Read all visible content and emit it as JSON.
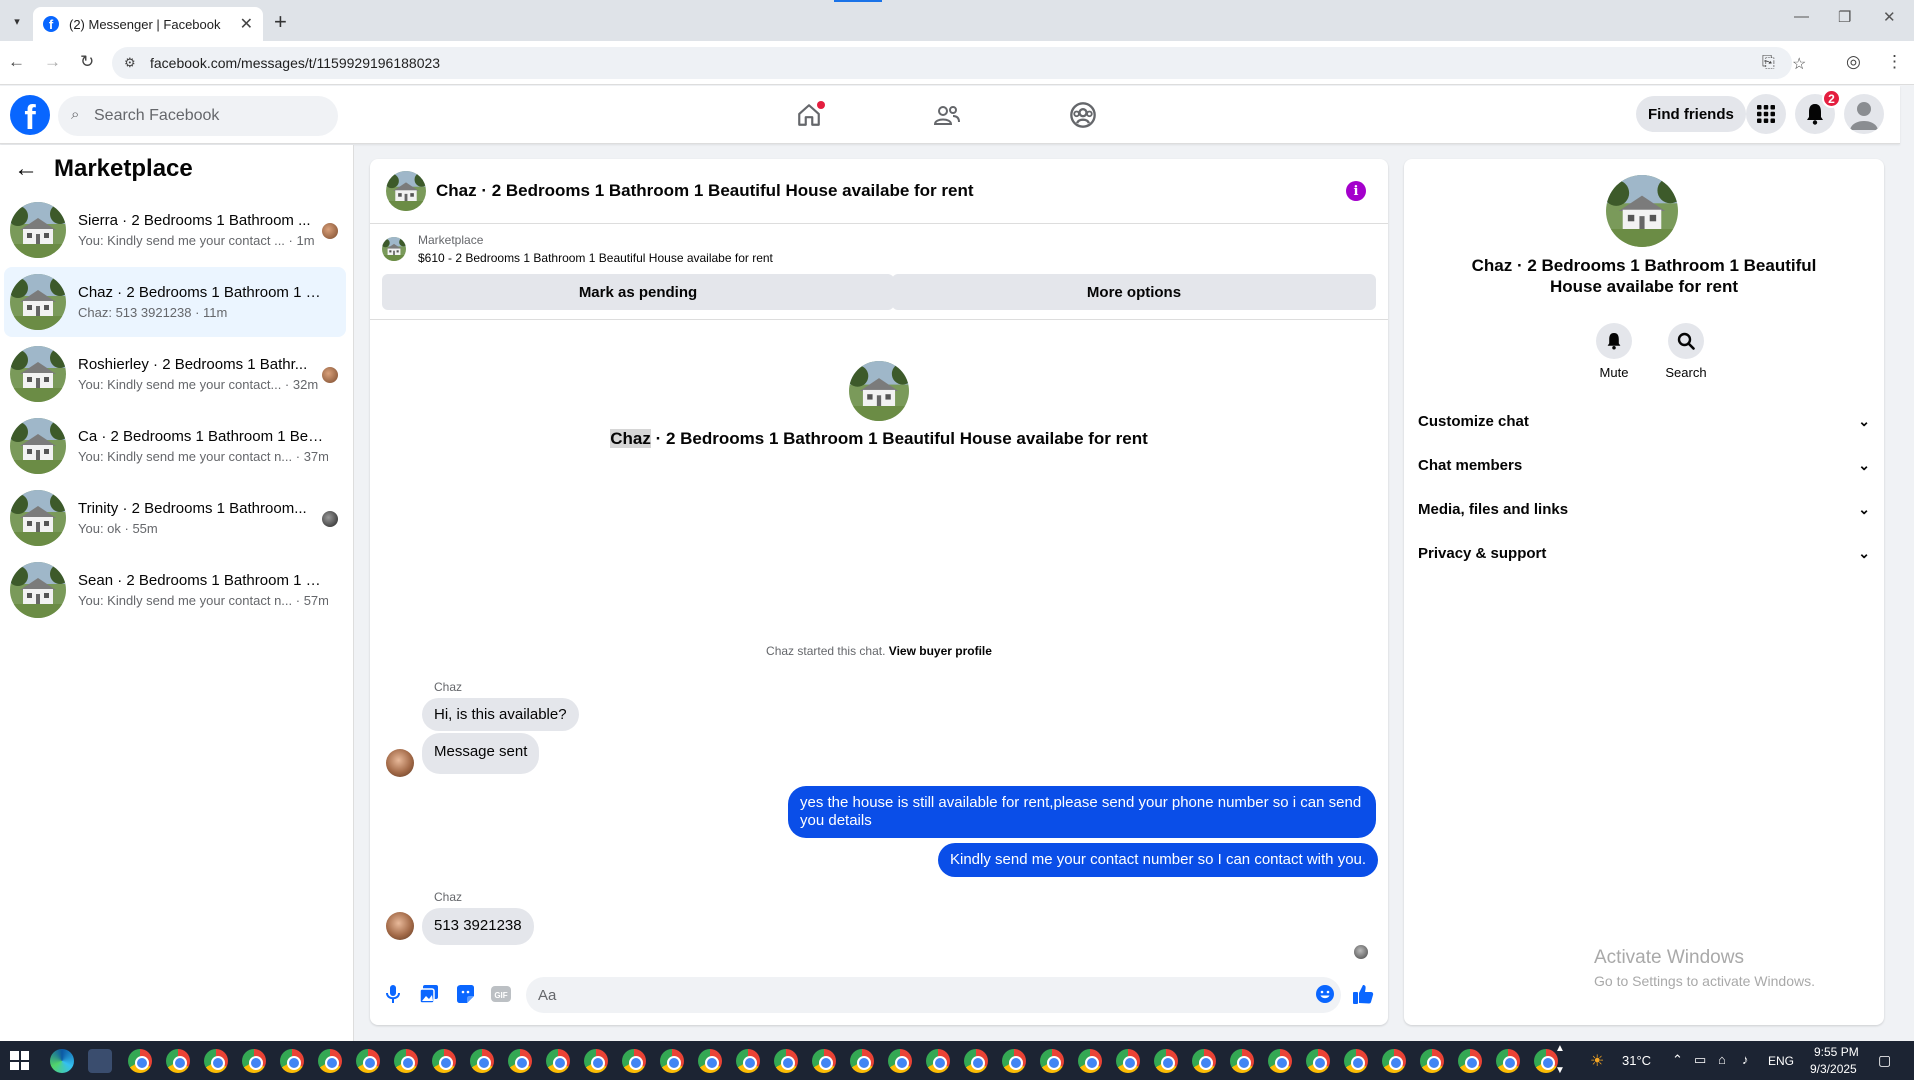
{
  "browser": {
    "tab_title": "(2) Messenger | Facebook",
    "url": "facebook.com/messages/t/1159929196188023"
  },
  "fb": {
    "search_placeholder": "Search Facebook",
    "find_friends": "Find friends",
    "notification_count": "2"
  },
  "left": {
    "title": "Marketplace",
    "conversations": [
      {
        "name": "Sierra · 2 Bedrooms 1 Bathroom ...",
        "preview": "You: Kindly send me your contact ... · 1m"
      },
      {
        "name": "Chaz · 2 Bedrooms 1 Bathroom 1 B...",
        "preview": "Chaz: 513 3921238 · 11m"
      },
      {
        "name": "Roshierley · 2 Bedrooms 1 Bathr...",
        "preview": "You: Kindly send me your contact... · 32m"
      },
      {
        "name": "Ca · 2 Bedrooms 1 Bathroom 1 Bea...",
        "preview": "You: Kindly send me your contact n... · 37m"
      },
      {
        "name": "Trinity · 2 Bedrooms 1 Bathroom...",
        "preview": "You: ok · 55m"
      },
      {
        "name": "Sean · 2 Bedrooms 1 Bathroom 1 B...",
        "preview": "You: Kindly send me your contact n... · 57m"
      }
    ]
  },
  "chat": {
    "header_title": "Chaz · 2 Bedrooms 1 Bathroom 1 Beautiful House availabe for rent",
    "marketplace_label": "Marketplace",
    "listing": "$610 - 2 Bedrooms 1 Bathroom 1 Beautiful House availabe for rent",
    "mark_pending": "Mark as pending",
    "more_options": "More options",
    "intro_name": "Chaz",
    "intro_rest": " · 2 Bedrooms 1 Bathroom 1 Beautiful House availabe for rent",
    "started_text": "Chaz started this chat. ",
    "view_buyer": "View buyer profile",
    "sender1": "Chaz",
    "msg1": "Hi, is this available?",
    "msg2": "Message sent",
    "out1": "yes the house is still available for rent,please send your  phone number so i can send you details",
    "out2": "Kindly send me your contact number so I can contact with you.",
    "sender2": "Chaz",
    "msg3": "513 3921238",
    "composer_placeholder": "Aa"
  },
  "right": {
    "title": "Chaz · 2 Bedrooms 1 Bathroom 1 Beautiful House availabe for rent",
    "mute": "Mute",
    "search": "Search",
    "rows": [
      "Customize chat",
      "Chat members",
      "Media, files and links",
      "Privacy & support"
    ],
    "activate_title": "Activate Windows",
    "activate_sub": "Go to Settings to activate Windows."
  },
  "taskbar": {
    "temperature": "31°C",
    "lang": "ENG",
    "time": "9:55 PM",
    "date": "9/3/2025"
  },
  "icons": [
    "search-icon",
    "home-icon",
    "friends-icon",
    "groups-icon",
    "apps-grid-icon",
    "bell-icon",
    "info-icon",
    "mic-icon",
    "image-icon",
    "sticker-icon",
    "gif-icon",
    "emoji-icon",
    "like-icon",
    "chevron-down-icon"
  ],
  "colors": {
    "brand": "#0866ff",
    "outgoing_bubble": "#0a4ee8",
    "badge": "#e41e3f",
    "info": "#a400cc"
  }
}
